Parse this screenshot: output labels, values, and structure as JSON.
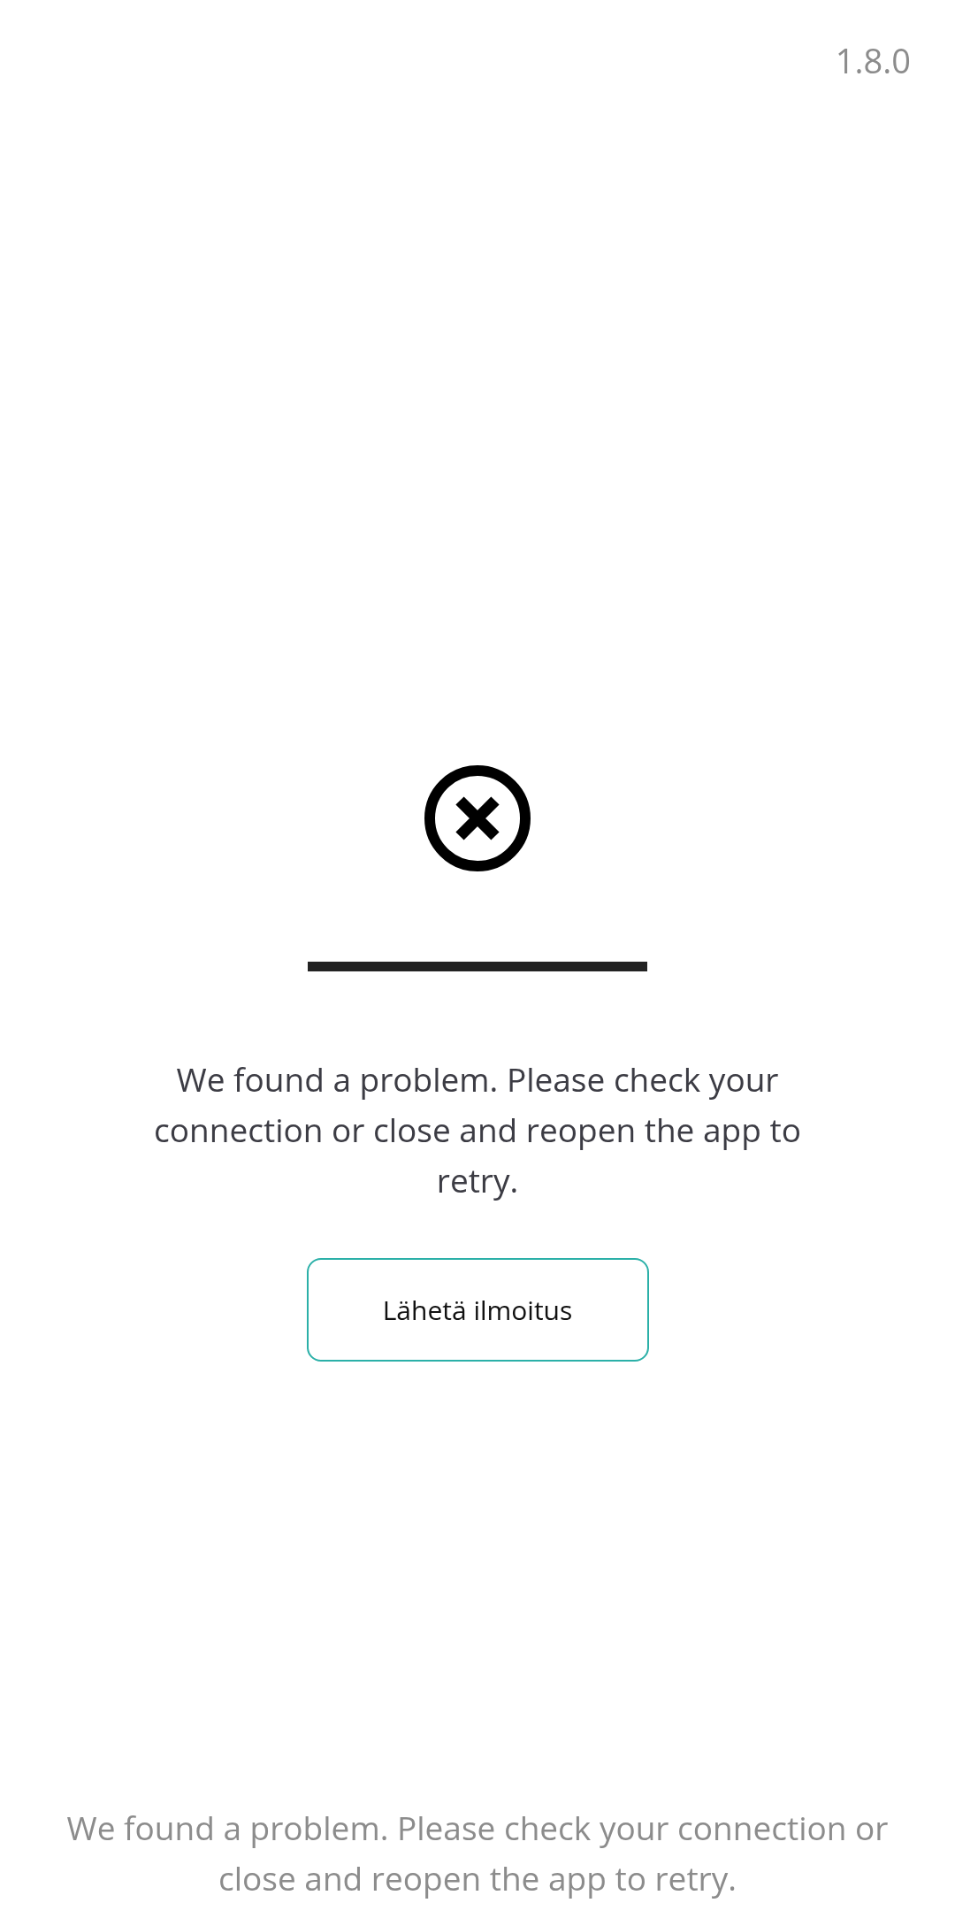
{
  "version": "1.8.0",
  "message": "We found a problem. Please check your connection or close and reopen the app to retry.",
  "button": {
    "label": "Lähetä ilmoitus"
  },
  "footer": "We found a problem. Please check your connection or close and reopen the app to retry."
}
